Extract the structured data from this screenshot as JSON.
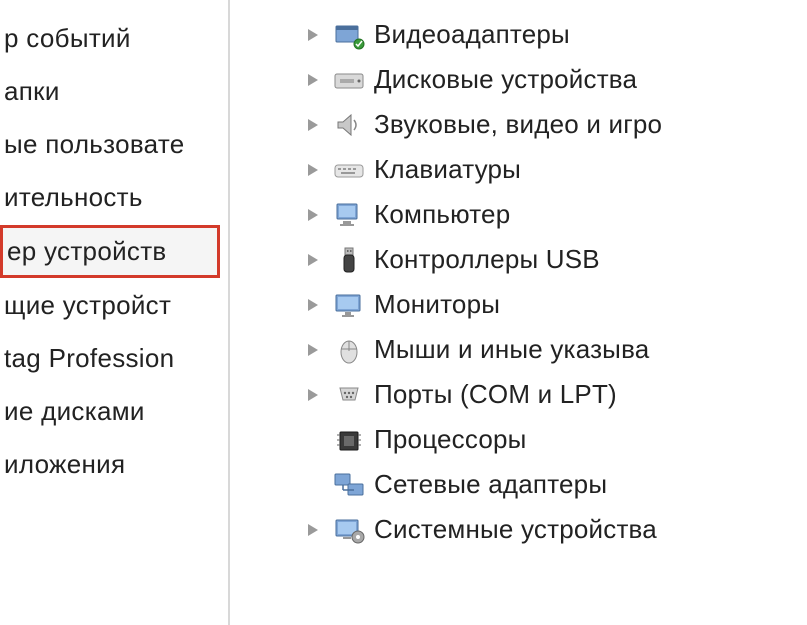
{
  "left_panel": {
    "items": [
      {
        "label": "р событий",
        "highlighted": false
      },
      {
        "label": "апки",
        "highlighted": false
      },
      {
        "label": "ые пользовате",
        "highlighted": false
      },
      {
        "label": "ительность",
        "highlighted": false
      },
      {
        "label": "ер устройств",
        "highlighted": true
      },
      {
        "label": "щие устройст",
        "highlighted": false
      },
      {
        "label": "tag Profession",
        "highlighted": false
      },
      {
        "label": "ие дисками",
        "highlighted": false
      },
      {
        "label": "иложения",
        "highlighted": false
      }
    ]
  },
  "device_tree": {
    "items": [
      {
        "icon": "video-adapter-icon",
        "label": "Видеоадаптеры",
        "expander": true
      },
      {
        "icon": "disk-drive-icon",
        "label": "Дисковые устройства",
        "expander": true
      },
      {
        "icon": "sound-icon",
        "label": "Звуковые, видео и игро",
        "expander": true
      },
      {
        "icon": "keyboard-icon",
        "label": "Клавиатуры",
        "expander": true
      },
      {
        "icon": "computer-icon",
        "label": "Компьютер",
        "expander": true
      },
      {
        "icon": "usb-icon",
        "label": "Контроллеры USB",
        "expander": true
      },
      {
        "icon": "monitor-icon",
        "label": "Мониторы",
        "expander": true
      },
      {
        "icon": "mouse-icon",
        "label": "Мыши и иные указыва",
        "expander": true
      },
      {
        "icon": "ports-icon",
        "label": "Порты (COM и LPT)",
        "expander": true
      },
      {
        "icon": "processor-icon",
        "label": "Процессоры",
        "expander": false
      },
      {
        "icon": "network-adapter-icon",
        "label": "Сетевые адаптеры",
        "expander": false
      },
      {
        "icon": "system-device-icon",
        "label": "Системные устройства",
        "expander": true
      }
    ]
  }
}
